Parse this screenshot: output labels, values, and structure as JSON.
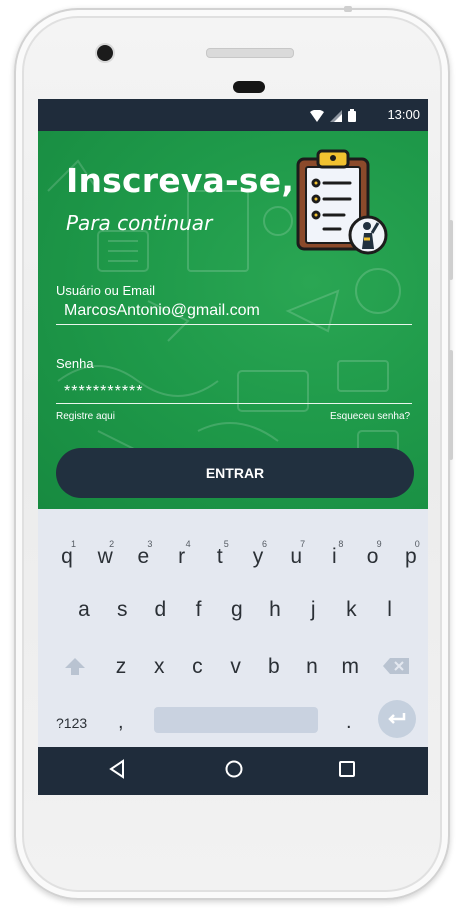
{
  "status_bar": {
    "time": "13:00"
  },
  "header": {
    "title": "Inscreva-se,",
    "subtitle": "Para continuar"
  },
  "form": {
    "user_label": "Usuário ou Email",
    "user_value": "MarcosAntonio@gmail.com",
    "password_label": "Senha",
    "password_value": "***********",
    "register_link": "Registre aqui",
    "forgot_link": "Esqueceu senha?",
    "submit_label": "ENTRAR"
  },
  "keyboard": {
    "row1": [
      {
        "key": "q",
        "hint": "1"
      },
      {
        "key": "w",
        "hint": "2"
      },
      {
        "key": "e",
        "hint": "3"
      },
      {
        "key": "r",
        "hint": "4"
      },
      {
        "key": "t",
        "hint": "5"
      },
      {
        "key": "y",
        "hint": "6"
      },
      {
        "key": "u",
        "hint": "7"
      },
      {
        "key": "i",
        "hint": "8"
      },
      {
        "key": "o",
        "hint": "9"
      },
      {
        "key": "p",
        "hint": "0"
      }
    ],
    "row2": [
      "a",
      "s",
      "d",
      "f",
      "g",
      "h",
      "j",
      "k",
      "l"
    ],
    "row3": [
      "z",
      "x",
      "c",
      "v",
      "b",
      "n",
      "m"
    ],
    "symbols_label": "?123",
    "comma": ",",
    "period": "."
  },
  "icons": {
    "wifi": "wifi-icon",
    "signal": "signal-icon",
    "battery": "battery-icon",
    "shift": "shift-arrow-icon",
    "backspace": "backspace-icon",
    "enter": "enter-arrow-icon",
    "back": "back-triangle-icon",
    "home": "home-circle-icon",
    "recents": "recents-square-icon",
    "clipboard": "clipboard-checklist-icon"
  },
  "colors": {
    "app_green": "#1f9a4a",
    "dark_navy": "#21303f",
    "keyboard_bg": "#e4e8f0",
    "white": "#ffffff"
  }
}
